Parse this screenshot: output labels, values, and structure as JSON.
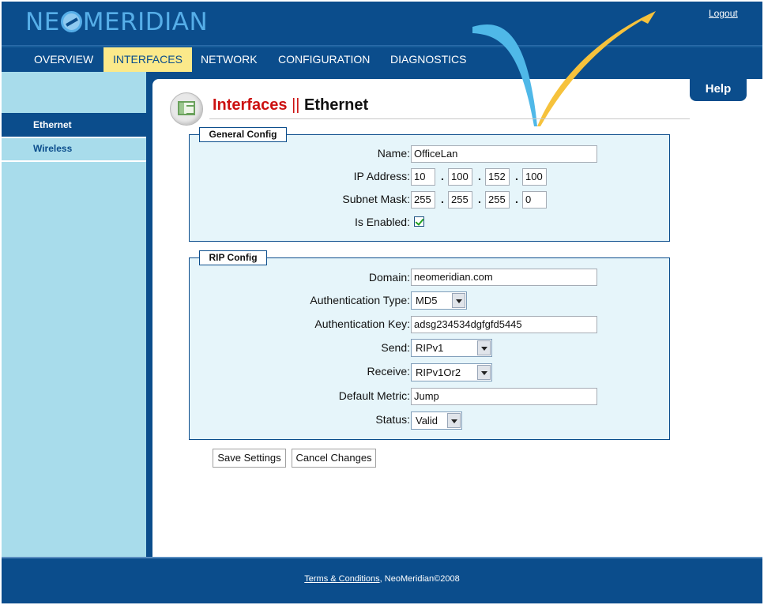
{
  "header": {
    "logo_text_1": "NE",
    "logo_text_2": "MERIDIAN",
    "logout_label": "Logout"
  },
  "nav": {
    "items": [
      {
        "label": "OVERVIEW"
      },
      {
        "label": "INTERFACES",
        "active": true
      },
      {
        "label": "NETWORK"
      },
      {
        "label": "CONFIGURATION"
      },
      {
        "label": "DIAGNOSTICS"
      }
    ]
  },
  "sidebar": {
    "items": [
      {
        "label": "Ethernet",
        "active": true
      },
      {
        "label": "Wireless"
      }
    ]
  },
  "page": {
    "title_section": "Interfaces",
    "title_sep": "||",
    "title_page": "Ethernet",
    "help_label": "Help"
  },
  "general": {
    "legend": "General Config",
    "name_label": "Name:",
    "name_value": "OfficeLan",
    "ip_label": "IP Address:",
    "ip": [
      "10",
      "100",
      "152",
      "100"
    ],
    "mask_label": "Subnet Mask:",
    "mask": [
      "255",
      "255",
      "255",
      "0"
    ],
    "enabled_label": "Is Enabled:",
    "enabled": true,
    "dot": "."
  },
  "rip": {
    "legend": "RIP Config",
    "domain_label": "Domain:",
    "domain_value": "neomeridian.com",
    "auth_type_label": "Authentication Type:",
    "auth_type_value": "MD5",
    "auth_key_label": "Authentication Key:",
    "auth_key_value": "adsg234534dgfgfd5445",
    "send_label": "Send:",
    "send_value": "RIPv1",
    "receive_label": "Receive:",
    "receive_value": "RIPv1Or2",
    "metric_label": "Default Metric:",
    "metric_value": "Jump",
    "status_label": "Status:",
    "status_value": "Valid"
  },
  "buttons": {
    "save_label": "Save Settings",
    "cancel_label": "Cancel Changes"
  },
  "footer": {
    "terms_label": "Terms & Conditions",
    "copyright": ", NeoMeridian©2008"
  },
  "colors": {
    "brand_navy": "#0b4d8c",
    "sidebar": "#a8dceb",
    "nav_active": "#fbe98a",
    "title_red": "#cc1111",
    "panel_bg": "#e6f5fa"
  }
}
